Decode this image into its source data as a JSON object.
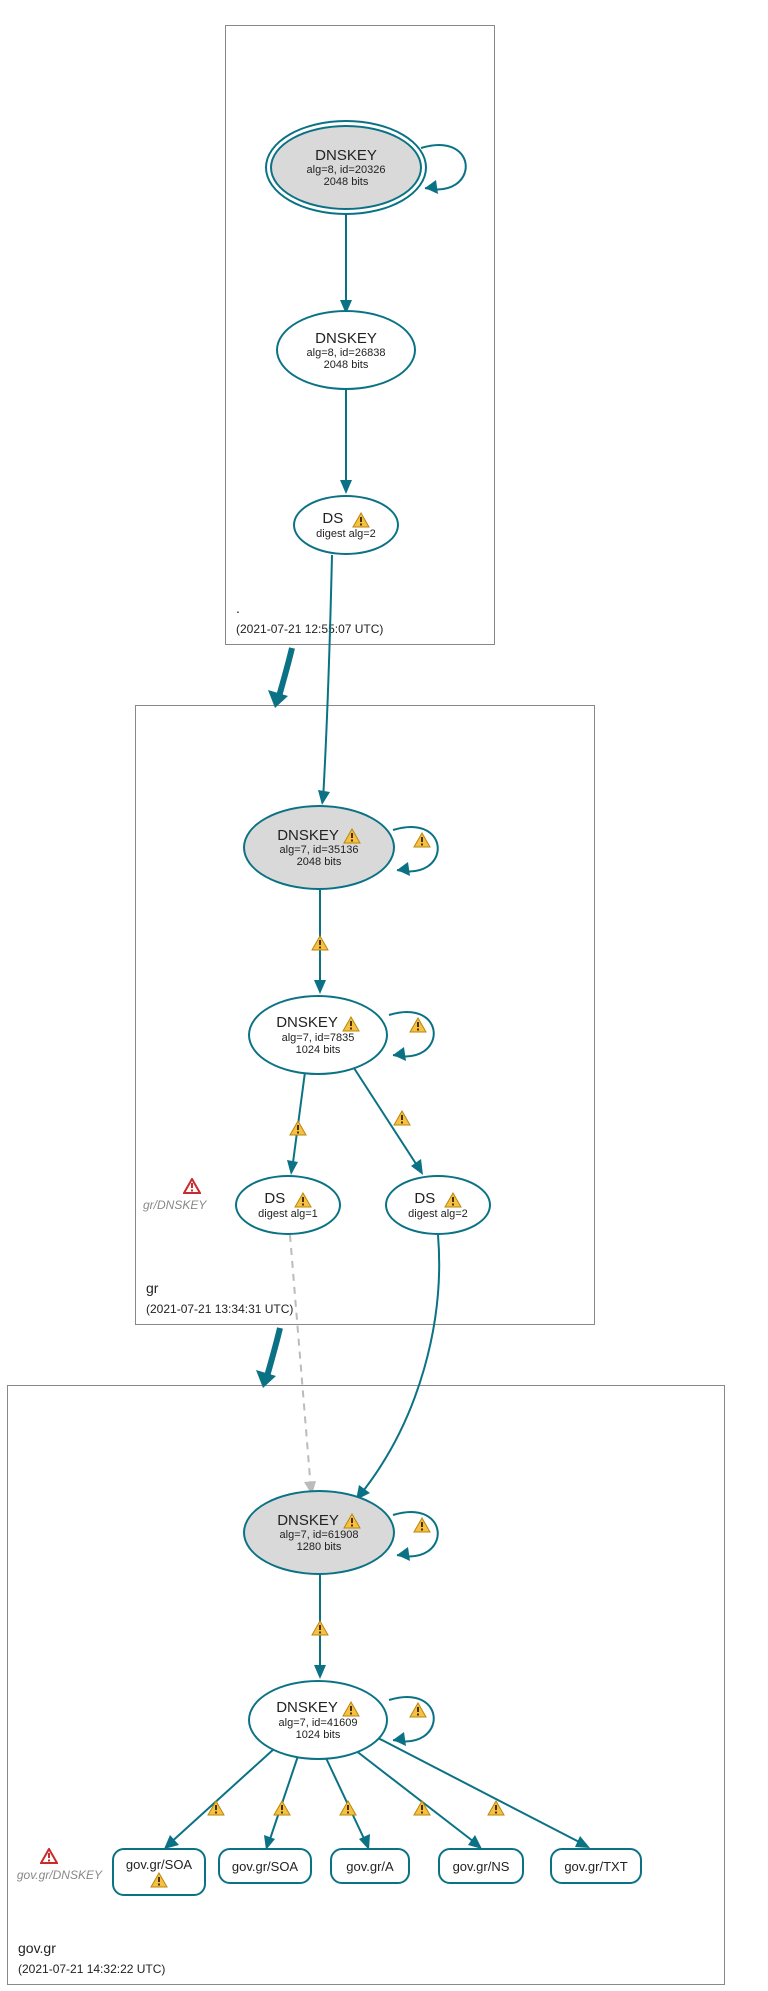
{
  "zones": {
    "root": {
      "name": ".",
      "timestamp": "(2021-07-21 12:55:07 UTC)"
    },
    "gr": {
      "name": "gr",
      "timestamp": "(2021-07-21 13:34:31 UTC)"
    },
    "gov": {
      "name": "gov.gr",
      "timestamp": "(2021-07-21 14:32:22 UTC)"
    }
  },
  "nodes": {
    "root_ksk": {
      "title": "DNSKEY",
      "sub1": "alg=8, id=20326",
      "sub2": "2048 bits"
    },
    "root_zsk": {
      "title": "DNSKEY",
      "sub1": "alg=8, id=26838",
      "sub2": "2048 bits"
    },
    "root_ds": {
      "title": "DS",
      "sub1": "digest alg=2"
    },
    "gr_ksk": {
      "title": "DNSKEY",
      "sub1": "alg=7, id=35136",
      "sub2": "2048 bits"
    },
    "gr_zsk": {
      "title": "DNSKEY",
      "sub1": "alg=7, id=7835",
      "sub2": "1024 bits"
    },
    "gr_ds1": {
      "title": "DS",
      "sub1": "digest alg=1"
    },
    "gr_ds2": {
      "title": "DS",
      "sub1": "digest alg=2"
    },
    "gov_ksk": {
      "title": "DNSKEY",
      "sub1": "alg=7, id=61908",
      "sub2": "1280 bits"
    },
    "gov_zsk": {
      "title": "DNSKEY",
      "sub1": "alg=7, id=41609",
      "sub2": "1024 bits"
    },
    "rr_soa1": {
      "title": "gov.gr/SOA"
    },
    "rr_soa2": {
      "title": "gov.gr/SOA"
    },
    "rr_a": {
      "title": "gov.gr/A"
    },
    "rr_ns": {
      "title": "gov.gr/NS"
    },
    "rr_txt": {
      "title": "gov.gr/TXT"
    }
  },
  "side_labels": {
    "gr": "gr/DNSKEY",
    "gov": "gov.gr/DNSKEY"
  }
}
